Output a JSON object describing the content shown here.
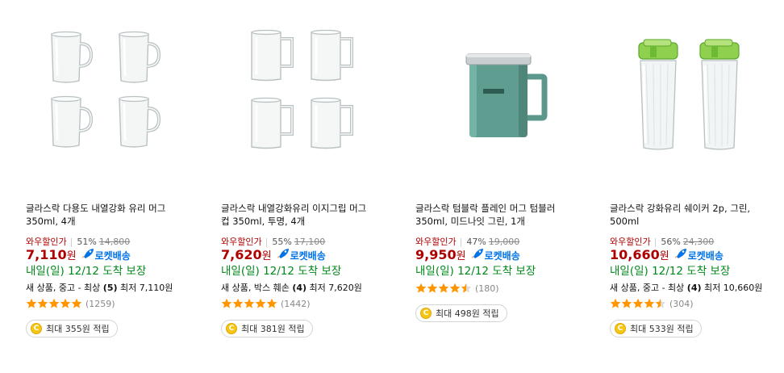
{
  "colors": {
    "price": "#ae0000",
    "rocket": "#0073e9",
    "delivery": "#00891a",
    "star": "#ff9600"
  },
  "products": [
    {
      "title_lines": [
        "글라스락 다용도 내열강화 유리 머그",
        "350ml, 4개"
      ],
      "wow_label": "와우할인가",
      "discount_rate": "51%",
      "original_price": "14,800",
      "price": "7,110",
      "won": "원",
      "rocket_label": "로켓배송",
      "delivery": "내일(일) 12/12 도착 보장",
      "condition_prefix": "새 상품, 중고 - 최상",
      "condition_count": "(5)",
      "condition_min": "최저 7,110원",
      "rating": 5.0,
      "review_count": "(1259)",
      "cashback": "최대 355원 적립",
      "coin_icon": "coin-icon"
    },
    {
      "title_lines": [
        "글라스락 내열강화유리 이지그립 머그",
        "컵 350ml, 투명, 4개"
      ],
      "wow_label": "와우할인가",
      "discount_rate": "55%",
      "original_price": "17,100",
      "price": "7,620",
      "won": "원",
      "rocket_label": "로켓배송",
      "delivery": "내일(일) 12/12 도착 보장",
      "condition_prefix": "새 상품, 박스 훼손",
      "condition_count": "(4)",
      "condition_min": "최저 7,620원",
      "rating": 5.0,
      "review_count": "(1442)",
      "cashback": "최대 381원 적립",
      "coin_icon": "coin-icon"
    },
    {
      "title_lines": [
        "글라스락 텀블락 플레인 머그 텀블러",
        "350ml, 미드나잇 그린, 1개"
      ],
      "wow_label": "와우할인가",
      "discount_rate": "47%",
      "original_price": "19,000",
      "price": "9,950",
      "won": "원",
      "rocket_label": "로켓배송",
      "delivery": "내일(일) 12/12 도착 보장",
      "rating": 4.5,
      "review_count": "(180)",
      "cashback": "최대 498원 적립",
      "coin_icon": "coin-icon"
    },
    {
      "title_lines": [
        "글라스락 강화유리 쉐이커 2p, 그린,",
        "500ml"
      ],
      "wow_label": "와우할인가",
      "discount_rate": "56%",
      "original_price": "24,300",
      "price": "10,660",
      "won": "원",
      "rocket_label": "로켓배송",
      "delivery": "내일(일) 12/12 도착 보장",
      "condition_prefix": "새 상품, 중고 - 최상",
      "condition_count": "(4)",
      "condition_min": "최저 10,660원",
      "rating": 4.5,
      "review_count": "(304)",
      "cashback": "최대 533원 적립",
      "coin_icon": "coin-icon"
    }
  ]
}
